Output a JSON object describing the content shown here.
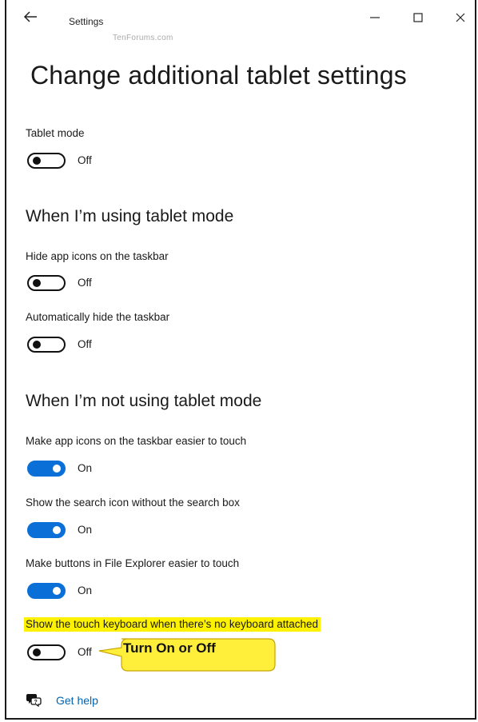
{
  "window": {
    "title": "Settings",
    "watermark": "TenForums.com",
    "icons": {
      "back": "back-arrow-icon",
      "minimize": "minimize-icon",
      "maximize": "maximize-icon",
      "close": "close-icon"
    }
  },
  "page": {
    "title": "Change additional tablet settings"
  },
  "settings": {
    "tablet_mode": {
      "label": "Tablet mode",
      "state": "Off",
      "on": false
    },
    "section_using": {
      "heading": "When I’m using tablet mode"
    },
    "hide_app_icons": {
      "label": "Hide app icons on the taskbar",
      "state": "Off",
      "on": false
    },
    "auto_hide_taskbar": {
      "label": "Automatically hide the taskbar",
      "state": "Off",
      "on": false
    },
    "section_not_using": {
      "heading": "When I’m not using tablet mode"
    },
    "easier_touch_icons": {
      "label": "Make app icons on the taskbar easier to touch",
      "state": "On",
      "on": true
    },
    "search_icon": {
      "label": "Show the search icon without the search box",
      "state": "On",
      "on": true
    },
    "explorer_buttons": {
      "label": "Make buttons in File Explorer easier to touch",
      "state": "On",
      "on": true
    },
    "touch_keyboard": {
      "label": "Show the touch keyboard when there’s no keyboard attached",
      "state": "Off",
      "on": false,
      "highlight_color": "#fff200"
    }
  },
  "callout": {
    "text": "Turn On or Off",
    "fill": "#ffef3a"
  },
  "help": {
    "icon": "chat-help-icon",
    "label": "Get help"
  },
  "colors": {
    "accent": "#0a6fd6",
    "link": "#0063b1"
  }
}
